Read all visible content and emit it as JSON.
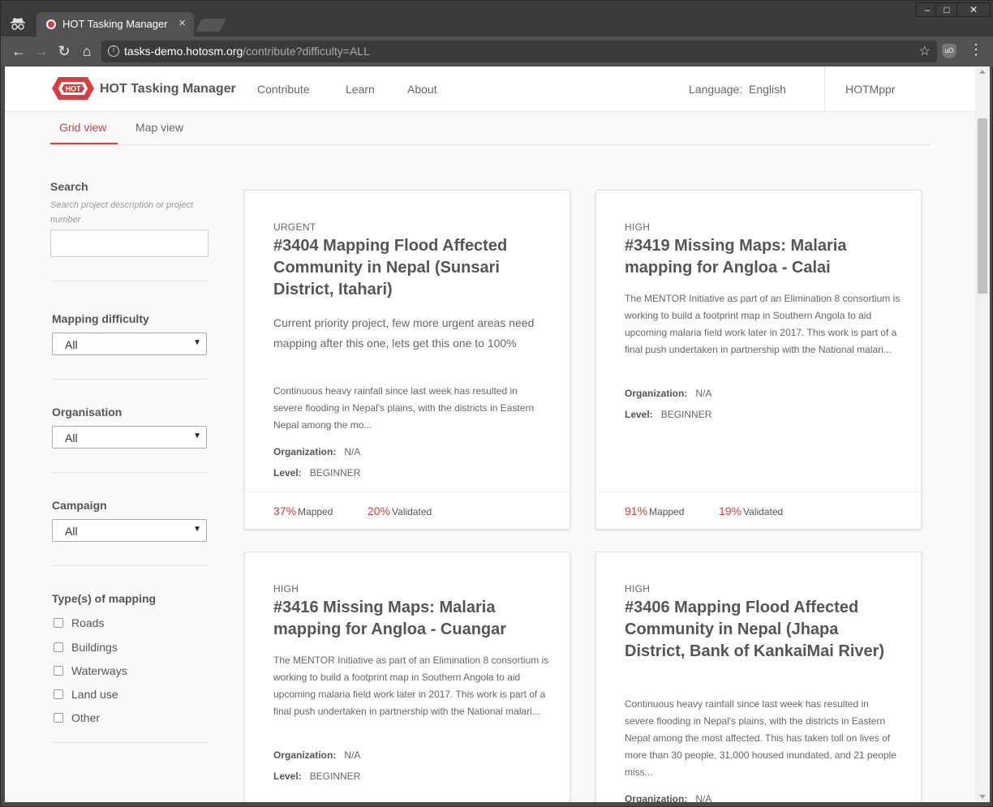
{
  "browser": {
    "tab_title": "HOT Tasking Manager",
    "tab_close": "×",
    "url_host": "tasks-demo.hotosm.org",
    "url_path": "/contribute?difficulty=ALL",
    "info": "i",
    "star": "☆",
    "ext_label": "uO",
    "menu": "⋮",
    "back": "←",
    "forward": "→",
    "reload": "↻",
    "home": "⌂",
    "minimize": "–",
    "maximize": "□",
    "close": "✕"
  },
  "header": {
    "logo_text": "HOT",
    "brand": "HOT Tasking Manager",
    "nav": [
      "Contribute",
      "Learn",
      "About"
    ],
    "language_label": "Language:",
    "language_value": "English",
    "username": "HOTMppr"
  },
  "view_tabs": {
    "grid": "Grid view",
    "map": "Map view"
  },
  "sidebar": {
    "search_heading": "Search",
    "search_hint": "Search project description or project number",
    "search_value": "",
    "difficulty_heading": "Mapping difficulty",
    "difficulty_value": "All",
    "organisation_heading": "Organisation",
    "organisation_value": "All",
    "campaign_heading": "Campaign",
    "campaign_value": "All",
    "types_heading": "Type(s) of mapping",
    "types": [
      "Roads",
      "Buildings",
      "Waterways",
      "Land use",
      "Other"
    ],
    "caret": "▼"
  },
  "labels": {
    "organization": "Organization:",
    "level": "Level:",
    "mapped": "Mapped",
    "validated": "Validated"
  },
  "cards": [
    {
      "priority": "URGENT",
      "title": "#3404 Mapping Flood Affected Community in Nepal (Sunsari District, Itahari)",
      "short": "Current priority project, few more urgent areas need mapping after this one, lets get this one to 100%",
      "description": "Continuous heavy rainfall since last week has resulted in severe flooding in Nepal's plains, with the districts in Eastern Nepal among the mo...",
      "organization": "N/A",
      "level": "BEGINNER",
      "mapped_pct": "37%",
      "validated_pct": "20%"
    },
    {
      "priority": "HIGH",
      "title": "#3419 Missing Maps: Malaria mapping for Angloa - Calai",
      "description": "The MENTOR Initiative as part of an Elimination 8 consortium is working to build a footprint map in Southern Angola to aid upcoming malaria field work later in 2017. This work is part of a final push undertaken in partnership with the National malari...",
      "organization": "N/A",
      "level": "BEGINNER",
      "mapped_pct": "91%",
      "validated_pct": "19%"
    },
    {
      "priority": "HIGH",
      "title": "#3416 Missing Maps: Malaria mapping for Angloa - Cuangar",
      "description": "The MENTOR Initiative as part of an Elimination 8 consortium is working to build a footprint map in Southern Angola to aid upcoming malaria field work later in 2017. This work is part of a final push undertaken in partnership with the National malari...",
      "organization": "N/A",
      "level": "BEGINNER"
    },
    {
      "priority": "HIGH",
      "title": "#3406 Mapping Flood Affected Community in Nepal (Jhapa District, Bank of KankaiMai River)",
      "description": "Continuous heavy rainfall since last week has resulted in severe flooding in Nepal's plains, with the districts in Eastern Nepal among the most affected. This has taken toll on lives of more than 30 people, 31,000 housed inundated, and 21 people miss...",
      "organization": "N/A"
    }
  ],
  "colors": {
    "accent": "#d73f3f",
    "text": "#555555",
    "page_bg": "#f9f9f9"
  }
}
